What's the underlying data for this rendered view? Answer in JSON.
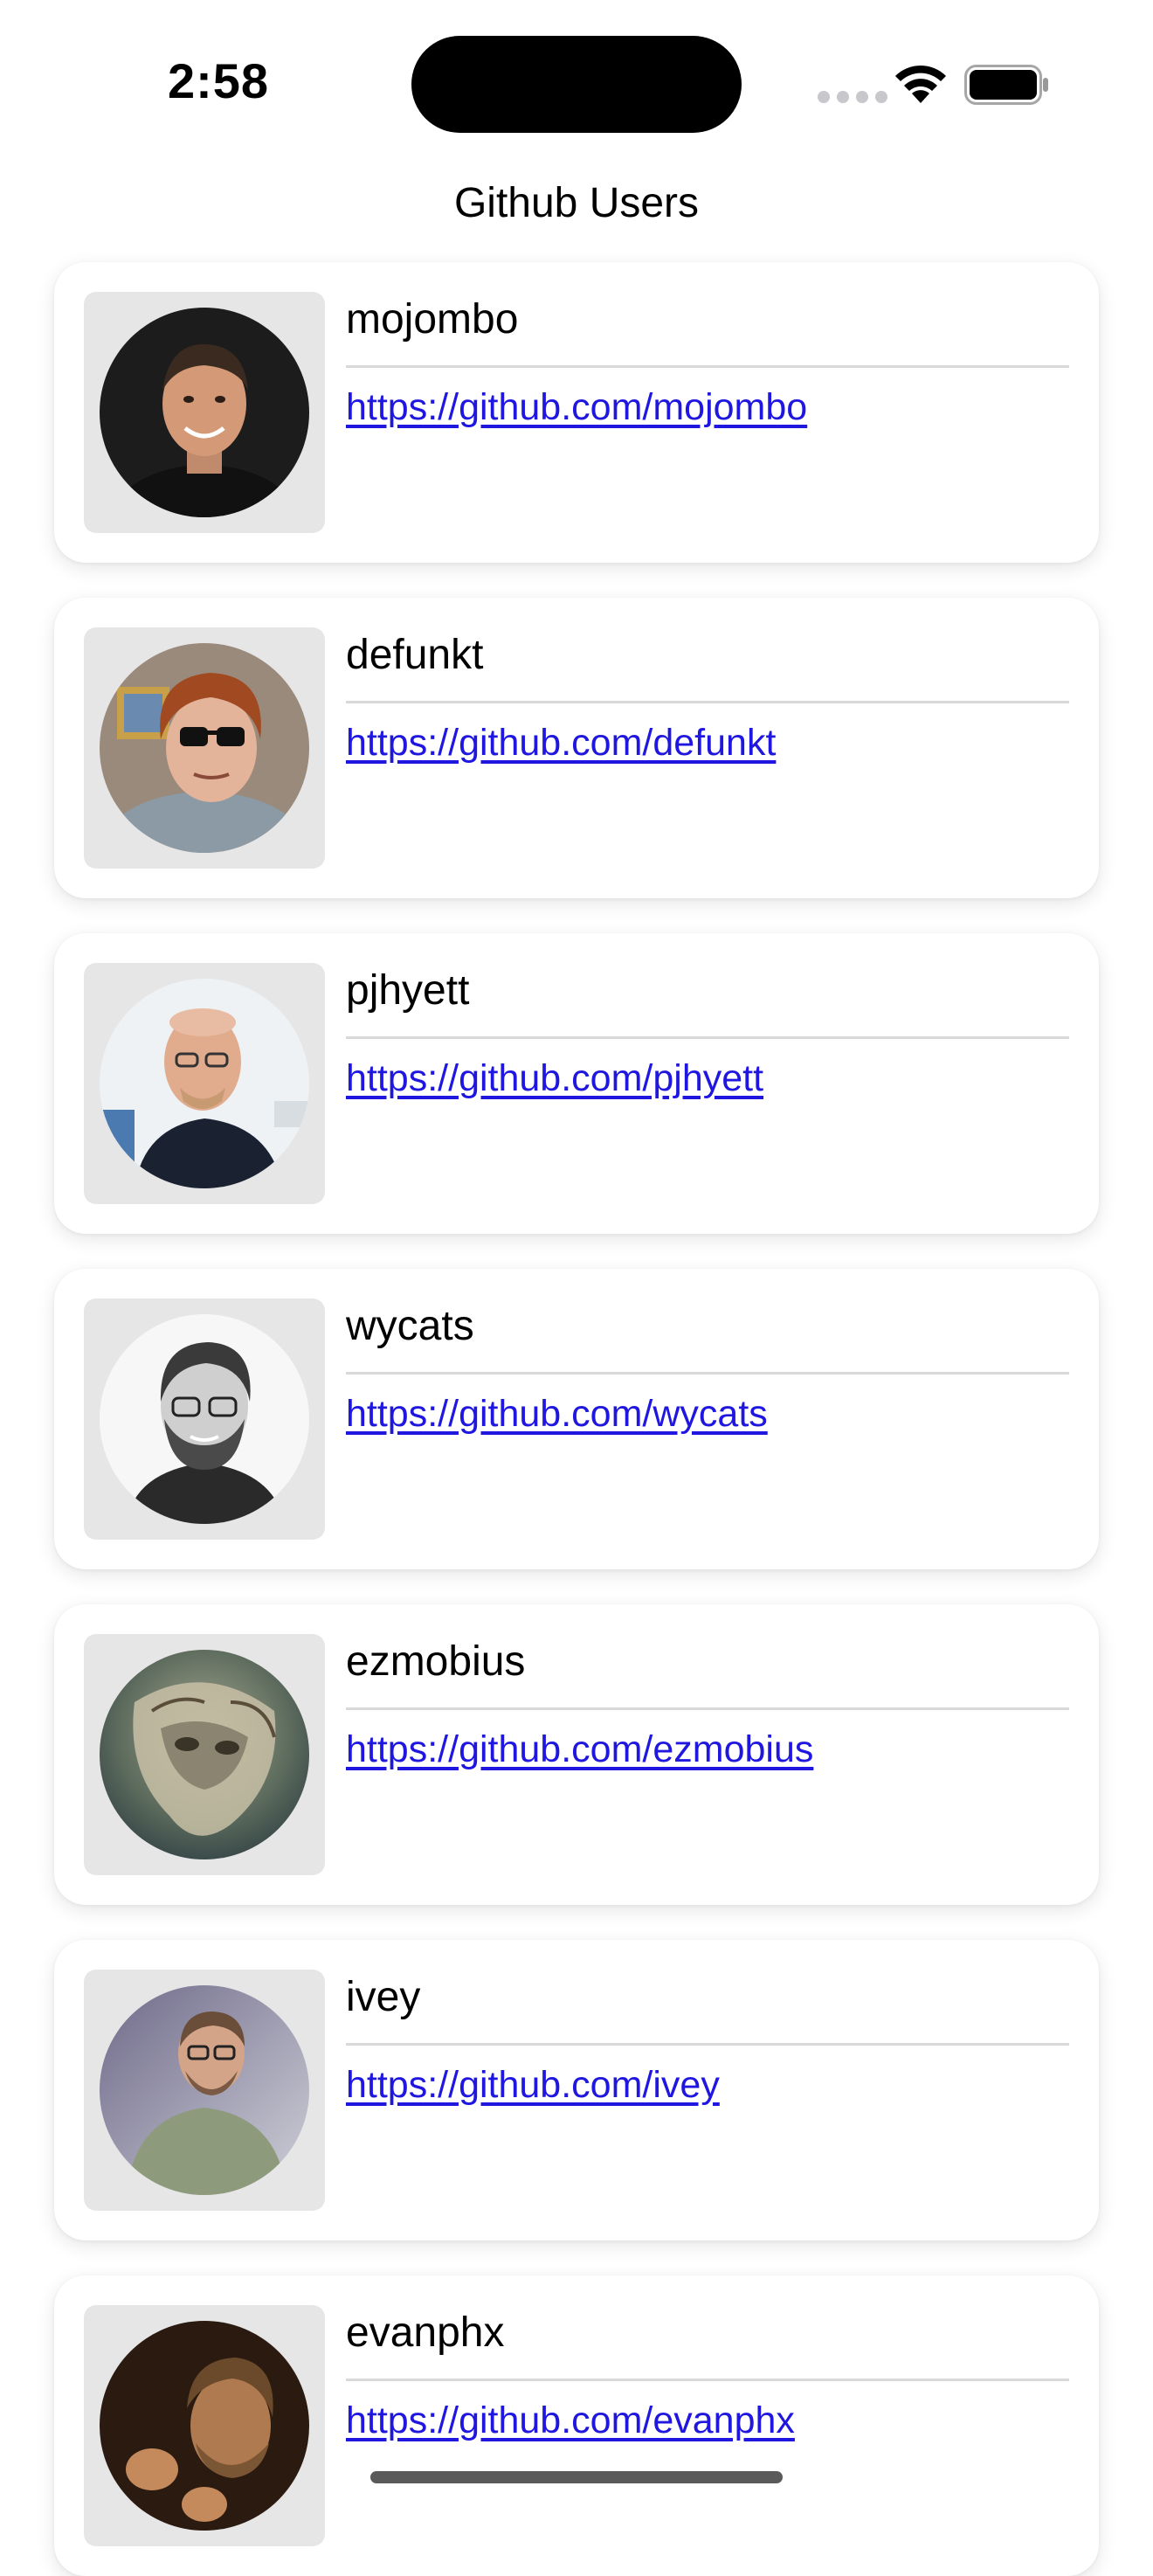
{
  "status_bar": {
    "time": "2:58"
  },
  "nav": {
    "title": "Github Users"
  },
  "users": [
    {
      "login": "mojombo",
      "url": "https://github.com/mojombo",
      "avatar_icon": "person-avatar"
    },
    {
      "login": "defunkt",
      "url": "https://github.com/defunkt",
      "avatar_icon": "person-avatar"
    },
    {
      "login": "pjhyett",
      "url": "https://github.com/pjhyett",
      "avatar_icon": "person-avatar"
    },
    {
      "login": "wycats",
      "url": "https://github.com/wycats",
      "avatar_icon": "person-avatar"
    },
    {
      "login": "ezmobius",
      "url": "https://github.com/ezmobius",
      "avatar_icon": "alien-avatar"
    },
    {
      "login": "ivey",
      "url": "https://github.com/ivey",
      "avatar_icon": "person-avatar"
    },
    {
      "login": "evanphx",
      "url": "https://github.com/evanphx",
      "avatar_icon": "person-avatar"
    }
  ],
  "colors": {
    "link": "#1f17e0",
    "avatar_bg": "#e6e6e6",
    "card_bg": "#ffffff"
  }
}
